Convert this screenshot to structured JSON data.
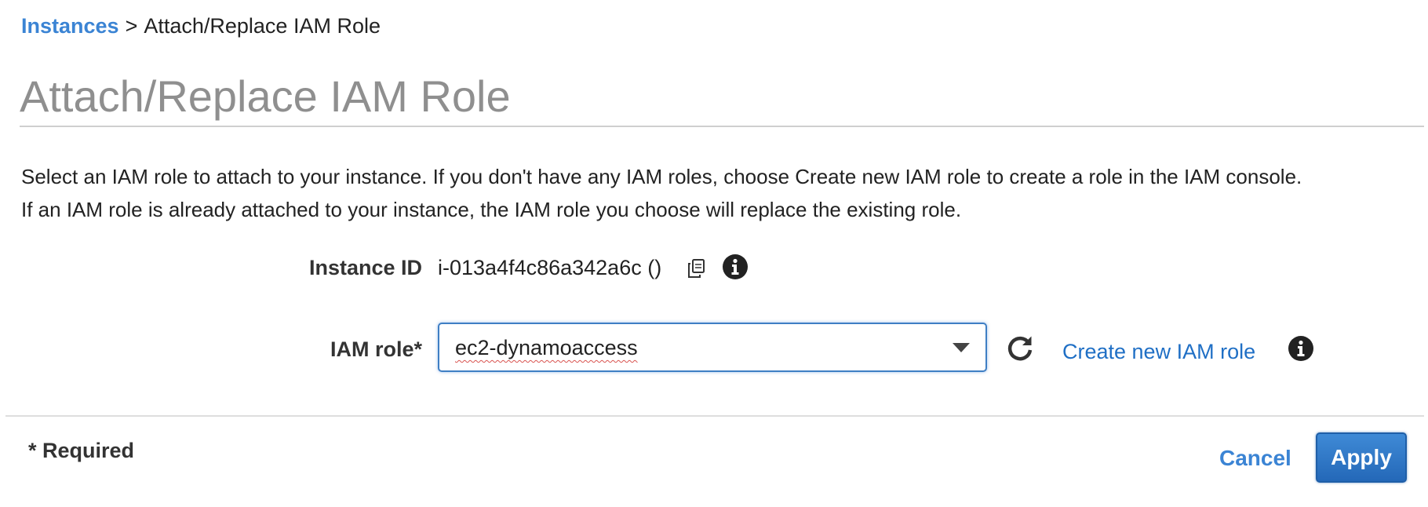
{
  "breadcrumb": {
    "parent": "Instances",
    "separator": ">",
    "current": "Attach/Replace IAM Role"
  },
  "page_title": "Attach/Replace IAM Role",
  "description": {
    "line1": "Select an IAM role to attach to your instance. If you don't have any IAM roles, choose Create new IAM role to create a role in the IAM console.",
    "line2": "If an IAM role is already attached to your instance, the IAM role you choose will replace the existing role."
  },
  "instance": {
    "label": "Instance ID",
    "value": "i-013a4f4c86a342a6c ()"
  },
  "iam_role": {
    "label": "IAM role*",
    "selected": "ec2-dynamoaccess",
    "create_link": "Create new IAM role"
  },
  "footer": {
    "required_note": "* Required",
    "cancel_label": "Cancel",
    "apply_label": "Apply"
  },
  "icons": {
    "copy": "copy-icon",
    "info": "info-icon",
    "refresh": "refresh-icon",
    "dropdown": "chevron-down-icon"
  },
  "colors": {
    "link": "#3b84d4",
    "primary_button": "#2a6fbf",
    "focus_border": "#3f7fc4",
    "title_gray": "#8f8f8f"
  }
}
